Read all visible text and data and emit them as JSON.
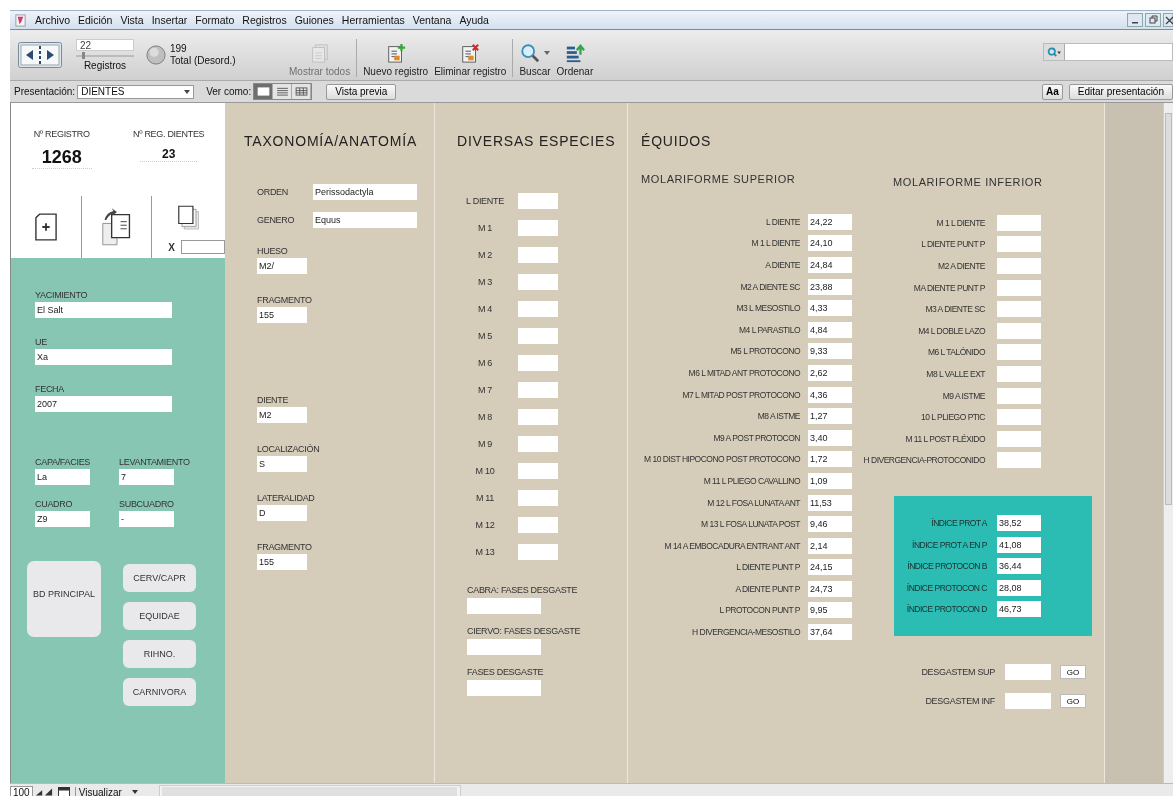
{
  "menu": [
    "Archivo",
    "Edición",
    "Vista",
    "Insertar",
    "Formato",
    "Registros",
    "Guiones",
    "Herramientas",
    "Ventana",
    "Ayuda"
  ],
  "toolbar": {
    "record_number": "22",
    "record_slider": {
      "level": 0.1
    },
    "records_label": "Registros",
    "total": "199",
    "total_label": "Total (Desord.)",
    "buttons": [
      {
        "kind": "show-all",
        "label": "Mostrar todos",
        "disabled": true
      },
      {
        "kind": "new",
        "label": "Nuevo registro",
        "disabled": false
      },
      {
        "kind": "delete",
        "label": "Eliminar registro",
        "disabled": false
      },
      {
        "kind": "find",
        "label": "Buscar",
        "disabled": false
      },
      {
        "kind": "sort",
        "label": "Ordenar",
        "disabled": false
      }
    ]
  },
  "layout_bar": {
    "layout_label": "Presentación:",
    "layout": "DIENTES",
    "view_label": "Ver como:",
    "views": [
      {
        "kind": "form",
        "selected": true
      },
      {
        "kind": "list",
        "selected": false
      },
      {
        "kind": "table",
        "selected": false
      }
    ],
    "preview": "Vista previa",
    "font_button": "Aa",
    "edit": "Editar presentación"
  },
  "record": {
    "number_label": "Nº REGISTRO",
    "number": "1268",
    "teeth_label": "Nº REG. DIENTES",
    "teeth_number": "23",
    "copies_label": "X"
  },
  "site": {
    "fields": [
      {
        "label": "YACIMIENTO",
        "value": "El Salt"
      },
      {
        "label": "UE",
        "value": "Xa"
      },
      {
        "label": "FECHA",
        "value": "2007"
      }
    ],
    "pairs": [
      {
        "label": "CAPA/FACIES",
        "value": "La"
      },
      {
        "label": "LEVANTAMIENTO",
        "value": "7"
      },
      {
        "label": "CUADRO",
        "value": "Z9"
      },
      {
        "label": "SUBCUADRO",
        "value": "-"
      }
    ],
    "main_button": "BD PRINCIPAL",
    "buttons": [
      "CERV/CAPR",
      "EQUIDAE",
      "RIHNO.",
      "CARNIVORA"
    ]
  },
  "taxonomy": {
    "title": "TAXONOMÍA/ANATOMÍA",
    "inline_fields": [
      {
        "label": "ORDEN",
        "value": "Perissodactyla"
      },
      {
        "label": "GENERO",
        "value": "Equus"
      }
    ],
    "bone_fields": [
      {
        "label": "HUESO",
        "value": "M2/"
      },
      {
        "label": "FRAGMENTO",
        "value": "155"
      }
    ],
    "tooth_fields": [
      {
        "label": "DIENTE",
        "value": "M2"
      },
      {
        "label": "LOCALIZACIÓN",
        "value": "S"
      },
      {
        "label": "LATERALIDAD",
        "value": "D"
      },
      {
        "label": "FRAGMENTO",
        "value": "155"
      }
    ]
  },
  "species": {
    "title": "DIVERSAS ESPECIES",
    "measures": [
      "L DIENTE",
      "M 1",
      "M 2",
      "M 3",
      "M 4",
      "M 5",
      "M 6",
      "M 7",
      "M 8",
      "M 9",
      "M 10",
      "M 11",
      "M 12",
      "M 13"
    ],
    "wear_fields": [
      "CABRA: FASES DESGASTE",
      "CIERVO: FASES DESGASTE",
      "FASES DESGASTE"
    ]
  },
  "equids": {
    "title": "ÉQUIDOS",
    "upper": {
      "title": "MOLARIFORME SUPERIOR",
      "rows": [
        {
          "label": "L DIENTE",
          "value": "24,22"
        },
        {
          "label": "M 1 L DIENTE",
          "value": "24,10"
        },
        {
          "label": "A DIENTE",
          "value": "24,84"
        },
        {
          "label": "M2 A DIENTE SC",
          "value": "23,88"
        },
        {
          "label": "M3 L MESOSTILO",
          "value": "4,33"
        },
        {
          "label": "M4 L PARASTILO",
          "value": "4,84"
        },
        {
          "label": "M5 L PROTOCONO",
          "value": "9,33"
        },
        {
          "label": "M6 L MITAD ANT PROTOCONO",
          "value": "2,62"
        },
        {
          "label": "M7 L MITAD POST PROTOCONO",
          "value": "4,36"
        },
        {
          "label": "M8 A ISTME",
          "value": "1,27"
        },
        {
          "label": "M9 A POST PROTOCON",
          "value": "3,40"
        },
        {
          "label": "M 10 DIST HIPOCONO POST PROTOCONO",
          "value": "1,72"
        },
        {
          "label": "M 11 L PLIEGO CAVALLINO",
          "value": "1,09"
        },
        {
          "label": "M 12 L FOSA LUNATA ANT",
          "value": "11,53"
        },
        {
          "label": "M 13 L FOSA LUNATA POST",
          "value": "9,46"
        },
        {
          "label": "M 14 A EMBOCADURA ENTRANT ANT",
          "value": "2,14"
        },
        {
          "label": "L DIENTE PUNT P",
          "value": "24,15"
        },
        {
          "label": "A DIENTE PUNT P",
          "value": "24,73"
        },
        {
          "label": "L PROTOCON PUNT P",
          "value": "9,95"
        },
        {
          "label": "H DIVERGENCIA-MESOSTILO",
          "value": "37,64"
        }
      ]
    },
    "lower": {
      "title": "MOLARIFORME INFERIOR",
      "rows": [
        "M 1 L DIENTE",
        "L DIENTE PUNT P",
        "M2 A DIENTE",
        "MA DIENTE PUNT P",
        "M3 A DIENTE SC",
        "M4 L DOBLE LAZO",
        "M6 L TALÓNIDO",
        "M8 L VALLE EXT",
        "M9 A ISTME",
        "10 L PLIEGO PTIC",
        "M 11 L POST FLÉXIDO",
        "H DIVERGENCIA-PROTOCONIDO"
      ]
    },
    "indices": [
      {
        "label": "ÍNDICE PROT A",
        "value": "38,52"
      },
      {
        "label": "ÍNDICE PROT A EN P",
        "value": "41,08"
      },
      {
        "label": "ÍNDICE PROTOCON B",
        "value": "36,44"
      },
      {
        "label": "ÍNDICE PROTOCON C",
        "value": "28,08"
      },
      {
        "label": "ÍNDICE PROTOCON D",
        "value": "46,73"
      }
    ],
    "wear": [
      {
        "label": "DESGASTEM SUP",
        "button": "GO"
      },
      {
        "label": "DESGASTEM INF",
        "button": "GO"
      }
    ]
  },
  "status_bar": {
    "zoom": "100",
    "mode": "Visualizar"
  }
}
